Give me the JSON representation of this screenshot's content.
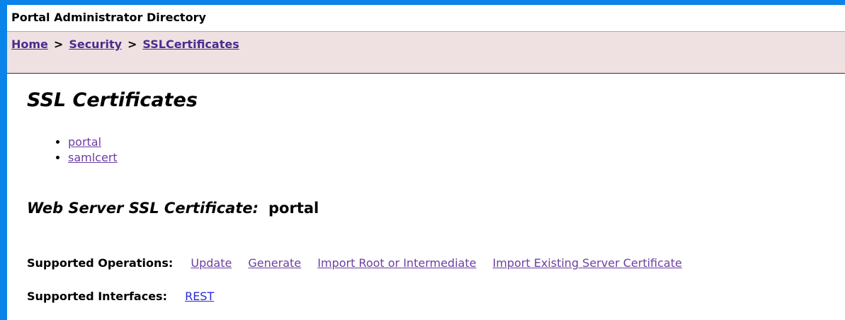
{
  "header": {
    "title": "Portal Administrator Directory"
  },
  "breadcrumb": {
    "items": [
      {
        "label": "Home"
      },
      {
        "label": "Security"
      },
      {
        "label": "SSLCertificates"
      }
    ],
    "separator": ">"
  },
  "main": {
    "title": "SSL Certificates",
    "certificates": [
      {
        "label": "portal"
      },
      {
        "label": "samlcert"
      }
    ],
    "web_server_cert": {
      "label": "Web Server SSL Certificate:",
      "value": "portal"
    },
    "supported_operations": {
      "label": "Supported Operations:",
      "items": [
        {
          "label": "Update"
        },
        {
          "label": "Generate"
        },
        {
          "label": "Import Root or Intermediate"
        },
        {
          "label": "Import Existing Server Certificate"
        }
      ]
    },
    "supported_interfaces": {
      "label": "Supported Interfaces:",
      "items": [
        {
          "label": "REST"
        }
      ]
    }
  },
  "colors": {
    "background": "#0a84e8",
    "breadcrumb_bg": "#efe1e1",
    "link_visited": "#6b3fa0",
    "link": "#2a2ad8"
  }
}
